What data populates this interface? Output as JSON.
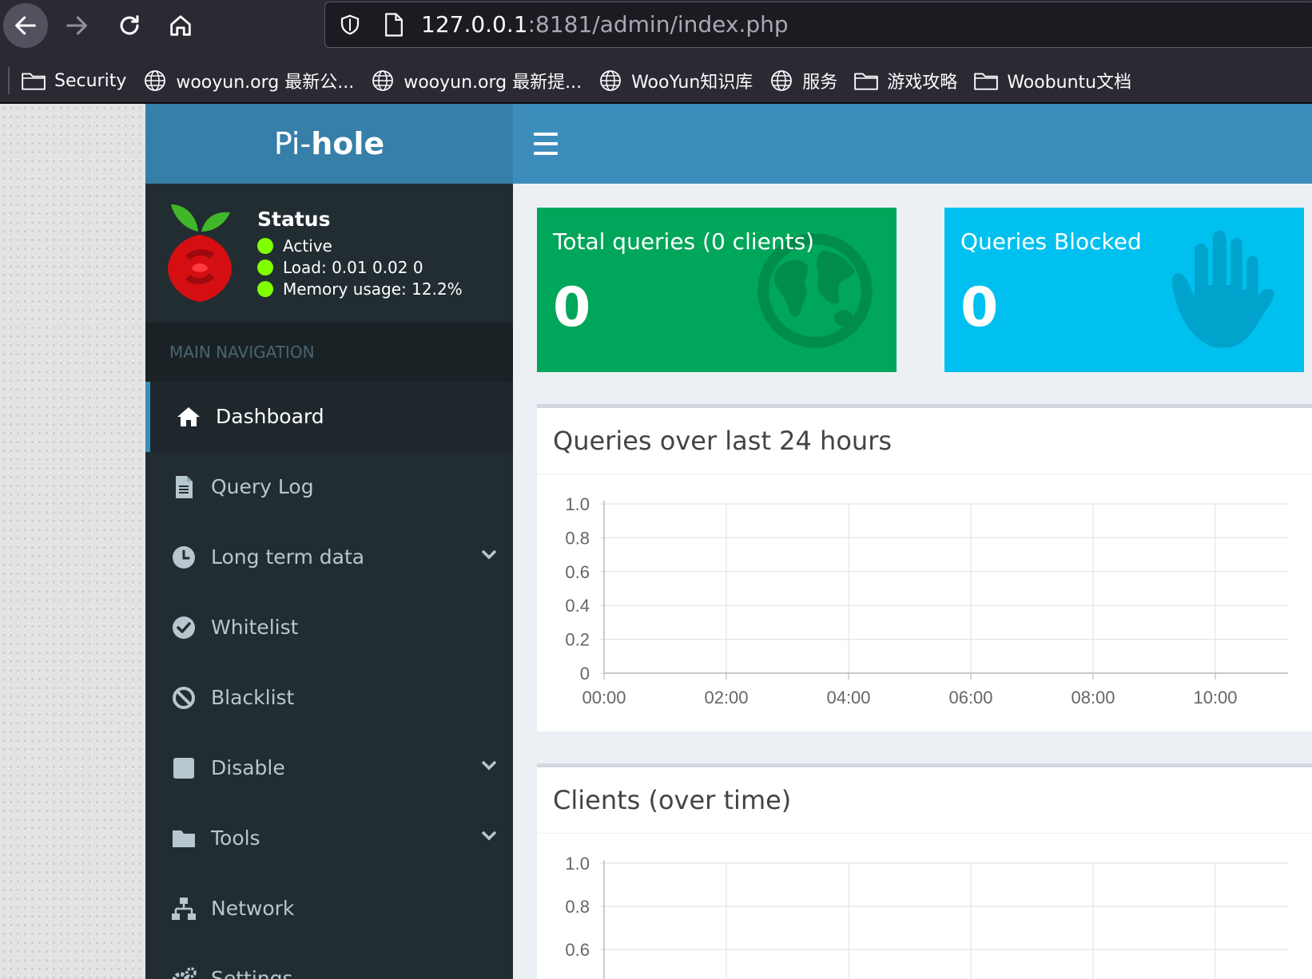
{
  "browser": {
    "url_host": "127.0.0.1",
    "url_rest": ":8181/admin/index.php",
    "bookmarks": [
      {
        "label": "Security",
        "icon": "folder-icon"
      },
      {
        "label": "wooyun.org 最新公...",
        "icon": "globe-icon"
      },
      {
        "label": "wooyun.org 最新提...",
        "icon": "globe-icon"
      },
      {
        "label": "WooYun知识库",
        "icon": "globe-icon"
      },
      {
        "label": "服务",
        "icon": "globe-icon"
      },
      {
        "label": "游戏攻略",
        "icon": "folder-icon"
      },
      {
        "label": "Woobuntu文档",
        "icon": "folder-icon"
      }
    ]
  },
  "header": {
    "logo_light": "Pi-",
    "logo_bold": "hole"
  },
  "sidebar": {
    "status_title": "Status",
    "status_active": "Active",
    "status_load": "Load:  0.01  0.02  0",
    "status_memory": "Memory usage:  12.2%",
    "status_dot_color": "#7fff00",
    "nav_header": "MAIN NAVIGATION",
    "items": [
      {
        "label": "Dashboard",
        "icon": "home-icon",
        "active": true
      },
      {
        "label": "Query Log",
        "icon": "file-icon"
      },
      {
        "label": "Long term data",
        "icon": "clock-icon",
        "has_submenu": true
      },
      {
        "label": "Whitelist",
        "icon": "check-circle-icon"
      },
      {
        "label": "Blacklist",
        "icon": "ban-icon"
      },
      {
        "label": "Disable",
        "icon": "stop-icon",
        "has_submenu": true
      },
      {
        "label": "Tools",
        "icon": "folder-icon",
        "has_submenu": true
      },
      {
        "label": "Network",
        "icon": "network-icon"
      },
      {
        "label": "Settings",
        "icon": "gears-icon"
      }
    ]
  },
  "stats": {
    "total_label": "Total queries (0 clients)",
    "total_value": "0",
    "total_color": "#00a65a",
    "blocked_label": "Queries Blocked",
    "blocked_value": "0",
    "blocked_color": "#00c0ef"
  },
  "panels": {
    "queries_title": "Queries over last 24 hours",
    "clients_title": "Clients (over time)"
  },
  "chart_data": [
    {
      "type": "line",
      "title": "Queries over last 24 hours",
      "x_ticks": [
        "00:00",
        "02:00",
        "04:00",
        "06:00",
        "08:00",
        "10:00"
      ],
      "y_ticks": [
        "1.0",
        "0.8",
        "0.6",
        "0.4",
        "0.2",
        "0"
      ],
      "ylim": [
        0,
        1
      ],
      "grid": true,
      "series": []
    },
    {
      "type": "line",
      "title": "Clients (over time)",
      "x_ticks": [],
      "y_ticks": [
        "1.0",
        "0.8",
        "0.6"
      ],
      "ylim": [
        0,
        1
      ],
      "grid": true,
      "series": []
    }
  ]
}
